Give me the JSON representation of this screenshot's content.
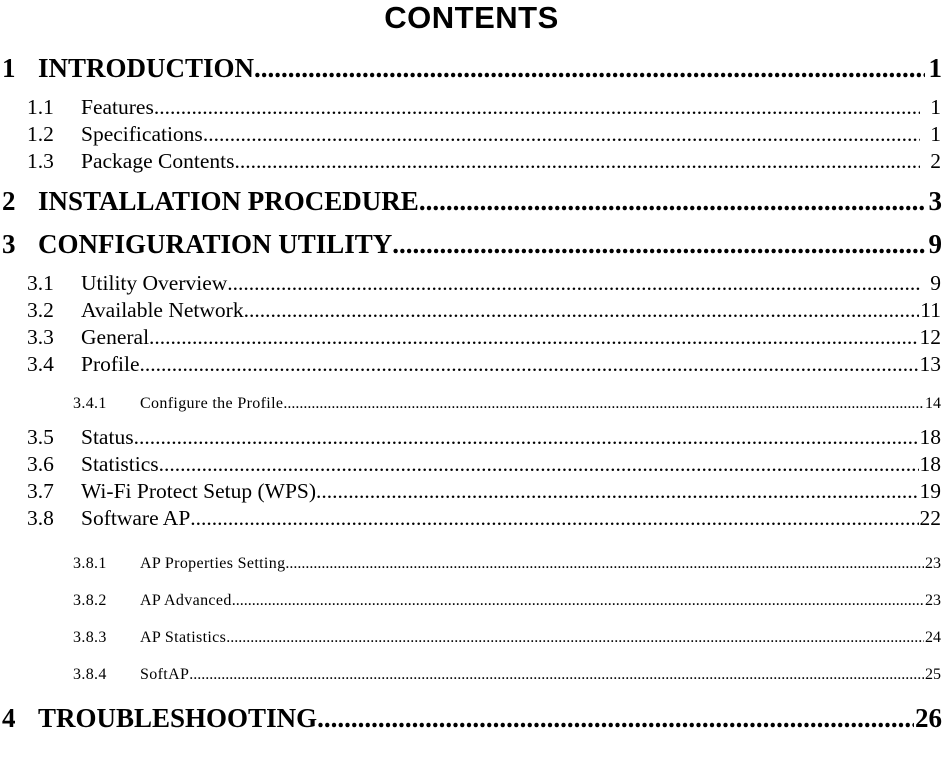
{
  "document": {
    "title": "CONTENTS"
  },
  "toc": {
    "entries": [
      {
        "level": 1,
        "number": "1",
        "text": "INTRODUCTION",
        "page": "1",
        "gap": "gap-md",
        "leader_gap_before": false
      },
      {
        "level": 2,
        "number": "1.1",
        "text": "Features",
        "page": "1",
        "gap": "gap-sm",
        "leader_gap_before": false
      },
      {
        "level": 2,
        "number": "1.2",
        "text": "Specifications",
        "page": "1",
        "gap": "gap-none",
        "leader_gap_before": false
      },
      {
        "level": 2,
        "number": "1.3",
        "text": "Package Contents",
        "page": "2",
        "gap": "gap-none",
        "leader_gap_before": false
      },
      {
        "level": 1,
        "number": "2",
        "text": "INSTALLATION PROCEDURE",
        "page": "3",
        "gap": "gap-sm",
        "leader_gap_before": true
      },
      {
        "level": 1,
        "number": "3",
        "text": "CONFIGURATION UTILITY",
        "page": "9",
        "gap": "gap-sm",
        "leader_gap_before": true
      },
      {
        "level": 2,
        "number": "3.1",
        "text": "Utility Overview",
        "page": "9",
        "gap": "gap-sm",
        "leader_gap_before": true
      },
      {
        "level": 2,
        "number": "3.2",
        "text": "Available Network",
        "page": "11",
        "gap": "gap-none",
        "leader_gap_before": true
      },
      {
        "level": 2,
        "number": "3.3",
        "text": "General",
        "page": "12",
        "gap": "gap-none",
        "leader_gap_before": false
      },
      {
        "level": 2,
        "number": "3.4",
        "text": "Profile",
        "page": "13",
        "gap": "gap-none",
        "leader_gap_before": false
      },
      {
        "level": 3,
        "number": "3.4.1",
        "text": "Configure the Profile",
        "page": "14",
        "gap": "gap-md",
        "leader_gap_before": true,
        "tracked": true
      },
      {
        "level": 2,
        "number": "3.5",
        "text": "Status",
        "page": "18",
        "gap": "gap-sm",
        "leader_gap_before": false
      },
      {
        "level": 2,
        "number": "3.6",
        "text": "Statistics",
        "page": "18",
        "gap": "gap-none",
        "leader_gap_before": true
      },
      {
        "level": 2,
        "number": "3.7",
        "text": "Wi-Fi Protect Setup (WPS)",
        "page": "19",
        "gap": "gap-none",
        "leader_gap_before": false
      },
      {
        "level": 2,
        "number": "3.8",
        "text": "Software AP",
        "page": "22",
        "gap": "gap-none",
        "leader_gap_before": true
      },
      {
        "level": 3,
        "number": "3.8.1",
        "text": "AP Properties Setting",
        "page": "23",
        "gap": "gap-lg",
        "leader_gap_before": true,
        "tracked": true
      },
      {
        "level": 3,
        "number": "3.8.2",
        "text": "AP Advanced",
        "page": "23",
        "gap": "gap-md",
        "leader_gap_before": true,
        "tracked": true
      },
      {
        "level": 3,
        "number": "3.8.3",
        "text": "AP Statistics",
        "page": "24",
        "gap": "gap-md",
        "leader_gap_before": true,
        "tracked": true
      },
      {
        "level": 3,
        "number": "3.8.4",
        "text": "SoftAP",
        "page": "25",
        "gap": "gap-md",
        "leader_gap_before": false,
        "tracked": true
      },
      {
        "level": 1,
        "number": "4",
        "text": "TROUBLESHOOTING",
        "page": "26",
        "gap": "gap-md",
        "leader_gap_before": true
      }
    ],
    "leader_char": "."
  }
}
